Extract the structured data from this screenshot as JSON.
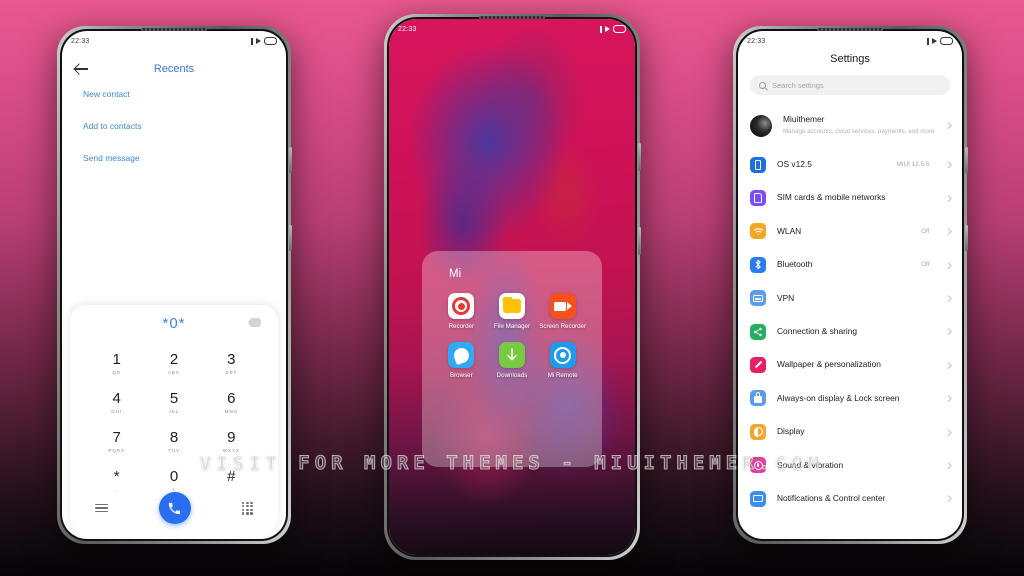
{
  "background": {
    "top_color": "#e8588f",
    "bottom_color": "#060406"
  },
  "watermark": {
    "text": "VISIT FOR MORE THEMES - MIUITHEMER.COM"
  },
  "phone_left": {
    "status": {
      "time": "22:33",
      "icons": [
        "play-triangle-icon",
        "battery-icon"
      ]
    },
    "header": {
      "back": "back-arrow",
      "title": "Recents"
    },
    "links": [
      "New contact",
      "Add to contacts",
      "Send message"
    ],
    "dialpad": {
      "display": "*0*",
      "backspace": "×",
      "keys": [
        {
          "digit": "1",
          "letters": "QD"
        },
        {
          "digit": "2",
          "letters": "ABC"
        },
        {
          "digit": "3",
          "letters": "DEF"
        },
        {
          "digit": "4",
          "letters": "GHI"
        },
        {
          "digit": "5",
          "letters": "JKL"
        },
        {
          "digit": "6",
          "letters": "MNO"
        },
        {
          "digit": "7",
          "letters": "PQRS"
        },
        {
          "digit": "8",
          "letters": "TUV"
        },
        {
          "digit": "9",
          "letters": "WXYZ"
        },
        {
          "digit": "*",
          "letters": ","
        },
        {
          "digit": "0",
          "letters": "+"
        },
        {
          "digit": "#",
          "letters": ""
        }
      ],
      "call_color": "#276ef1"
    }
  },
  "phone_middle": {
    "status": {
      "time": "22:33",
      "icons": [
        "play-triangle-icon",
        "battery-icon"
      ]
    },
    "folder": {
      "title": "Mi",
      "apps": [
        {
          "label": "Recorder",
          "icon": "recorder-icon",
          "color": "#ffffff"
        },
        {
          "label": "File Manager",
          "icon": "file-manager-icon",
          "color": "#ffffff"
        },
        {
          "label": "Screen Recorder",
          "icon": "screen-recorder-icon",
          "color": "#f4511e"
        },
        {
          "label": "Browser",
          "icon": "browser-icon",
          "color": "#33a8f5"
        },
        {
          "label": "Downloads",
          "icon": "downloads-icon",
          "color": "#7ac943"
        },
        {
          "label": "Mi Remote",
          "icon": "mi-remote-icon",
          "color": "#1e9bf0"
        }
      ]
    }
  },
  "phone_right": {
    "status": {
      "time": "22:33",
      "icons": [
        "play-triangle-icon",
        "battery-icon"
      ]
    },
    "title": "Settings",
    "search": {
      "placeholder": "Search settings",
      "icon": "search-icon"
    },
    "items": [
      {
        "label": "Miuithemer",
        "sub": "Manage accounts, cloud services, payments, and more",
        "value": "",
        "icon": "avatar",
        "color": "#1a1a1a"
      },
      {
        "label": "OS v12.5",
        "sub": "",
        "value": "MIUI 12.5.5",
        "icon": "os-icon",
        "color": "#1f6fe0"
      },
      {
        "label": "SIM cards & mobile networks",
        "sub": "",
        "value": "",
        "icon": "sim-icon",
        "color": "#7c4dff"
      },
      {
        "label": "WLAN",
        "sub": "",
        "value": "Off",
        "icon": "wifi-icon",
        "color": "#f5a623"
      },
      {
        "label": "Bluetooth",
        "sub": "",
        "value": "Off",
        "icon": "bluetooth-icon",
        "color": "#2a7def"
      },
      {
        "label": "VPN",
        "sub": "",
        "value": "",
        "icon": "vpn-icon",
        "color": "#5b9cf0"
      },
      {
        "label": "Connection & sharing",
        "sub": "",
        "value": "",
        "icon": "share-icon",
        "color": "#27ae60"
      },
      {
        "label": "Wallpaper & personalization",
        "sub": "",
        "value": "",
        "icon": "wallpaper-icon",
        "color": "#e91e63"
      },
      {
        "label": "Always-on display & Lock screen",
        "sub": "",
        "value": "",
        "icon": "lock-icon",
        "color": "#5b9cf0"
      },
      {
        "label": "Display",
        "sub": "",
        "value": "",
        "icon": "display-icon",
        "color": "#f0a830"
      },
      {
        "label": "Sound & vibration",
        "sub": "",
        "value": "",
        "icon": "sound-icon",
        "color": "#e040a0"
      },
      {
        "label": "Notifications & Control center",
        "sub": "",
        "value": "",
        "icon": "notification-icon",
        "color": "#3b8ef0"
      }
    ]
  }
}
